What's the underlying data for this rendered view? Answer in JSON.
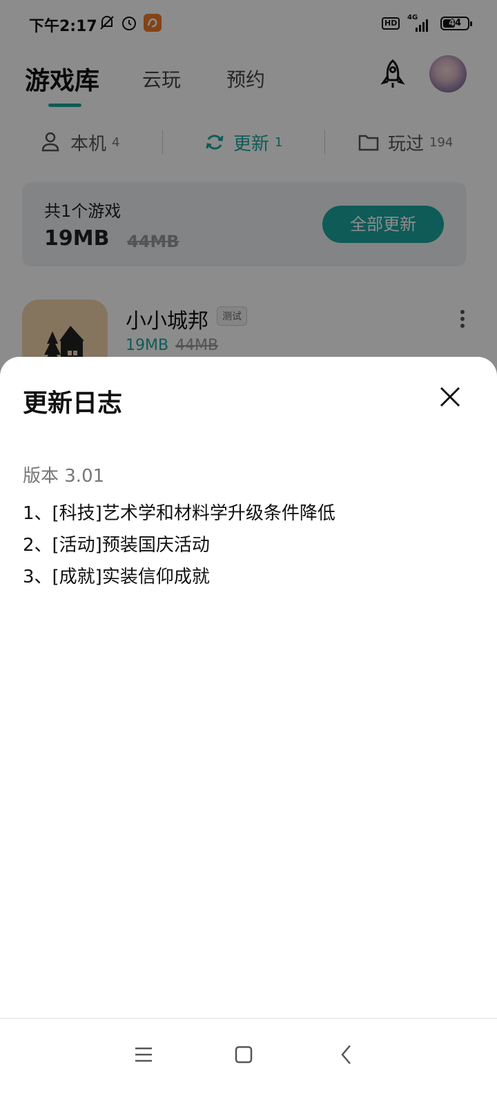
{
  "status_bar": {
    "time": "下午2:17",
    "hd": "HD",
    "network": "4G",
    "battery_level": "44",
    "icons": [
      "notifications-off-icon",
      "alarm-icon",
      "app-notification-icon"
    ]
  },
  "top_tabs": {
    "main": "游戏库",
    "cloud": "云玩",
    "reserve": "预约"
  },
  "sub_tabs": [
    {
      "label": "本机",
      "count": "4",
      "icon": "local-icon"
    },
    {
      "label": "更新",
      "count": "1",
      "icon": "refresh-icon"
    },
    {
      "label": "玩过",
      "count": "194",
      "icon": "folder-icon"
    }
  ],
  "summary": {
    "count_text": "共1个游戏",
    "size_new": "19MB",
    "size_old": "44MB",
    "update_all": "全部更新"
  },
  "game": {
    "name": "小小城邦",
    "badge": "测试",
    "size_new": "19MB",
    "size_old": "44MB"
  },
  "sheet": {
    "title": "更新日志",
    "version": "版本 3.01",
    "lines": [
      "1、[科技]艺术学和材料学升级条件降低",
      "2、[活动]预装国庆活动",
      "3、[成就]实装信仰成就"
    ]
  },
  "colors": {
    "accent": "#1aa7a0",
    "dim_overlay": "rgba(0,0,0,0.45)"
  },
  "nav": [
    "menu-icon",
    "home-icon",
    "back-icon"
  ]
}
